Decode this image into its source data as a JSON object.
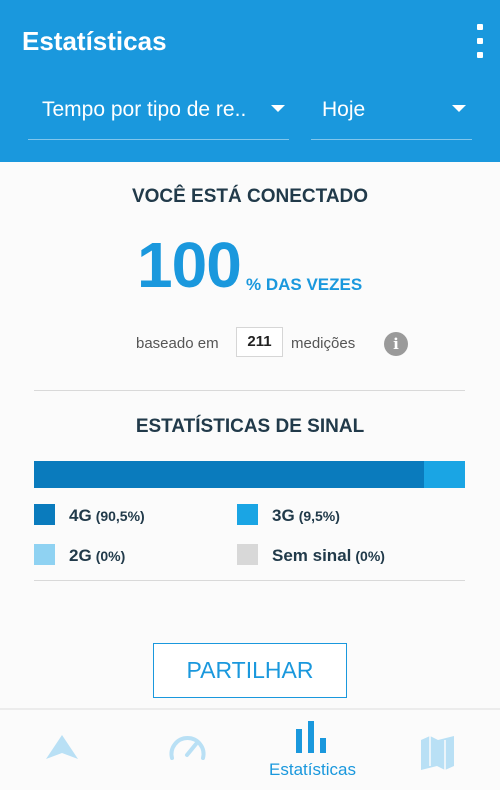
{
  "header": {
    "title": "Estatísticas",
    "menu_icon": "more-vert-icon",
    "filters": [
      {
        "label": "Tempo por tipo de re..",
        "icon": "caret-down-icon"
      },
      {
        "label": "Hoje",
        "icon": "caret-down-icon"
      }
    ]
  },
  "connection": {
    "title": "VOCÊ ESTÁ CONECTADO",
    "percent": "100",
    "suffix": "% DAS VEZES",
    "based_on": "baseado em",
    "count": "211",
    "measurements": "medições",
    "info_icon": "info-icon",
    "info_glyph": "i"
  },
  "signal": {
    "title": "ESTATÍSTICAS DE SINAL",
    "legend": [
      {
        "name": "4G",
        "pct": "(90,5%)",
        "value": 90.5,
        "color": "#0a7bbd"
      },
      {
        "name": "3G",
        "pct": "(9,5%)",
        "value": 9.5,
        "color": "#1aa5e4"
      },
      {
        "name": "2G",
        "pct": "(0%)",
        "value": 0,
        "color": "#8fd2f2"
      },
      {
        "name": "Sem sinal",
        "pct": "(0%)",
        "value": 0,
        "color": "#d8d8d8"
      }
    ]
  },
  "actions": {
    "share_label": "PARTILHAR"
  },
  "bottom_nav": [
    {
      "icon": "navigation-arrow-icon",
      "label": "",
      "active": false
    },
    {
      "icon": "speedometer-icon",
      "label": "",
      "active": false
    },
    {
      "icon": "bar-chart-icon",
      "label": "Estatísticas",
      "active": true
    },
    {
      "icon": "map-icon",
      "label": "",
      "active": false
    }
  ],
  "colors": {
    "primary": "#1a98dd",
    "dark_text": "#213a4a",
    "inactive_nav": "#b9e0f5"
  }
}
